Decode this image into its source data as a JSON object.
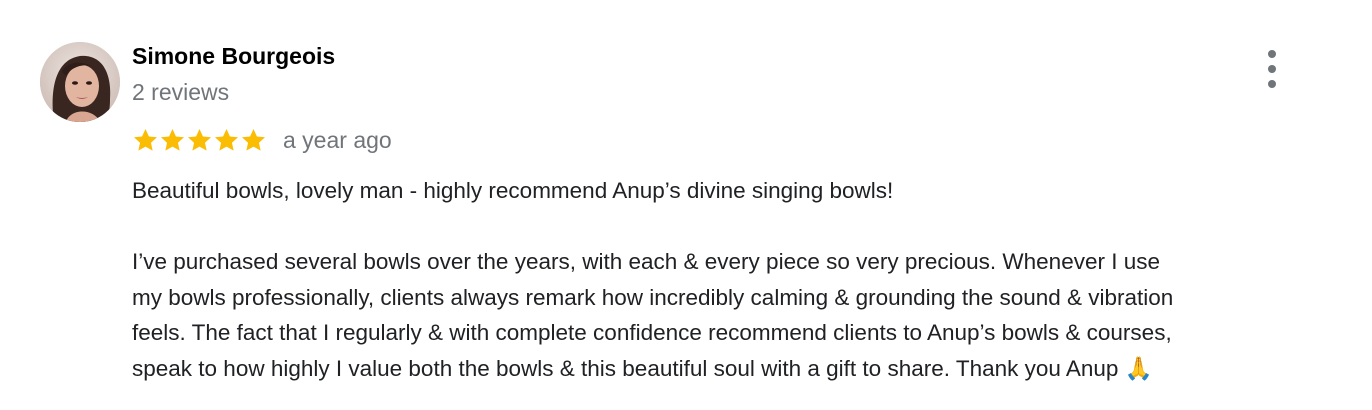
{
  "review": {
    "author_name": "Simone Bourgeois",
    "reviews_count": "2 reviews",
    "rating": 5,
    "rating_max": 5,
    "star_color": "#fbbc04",
    "time_ago": "a year ago",
    "more_icon": "more-vert-icon",
    "text": {
      "paragraph1": "Beautiful bowls, lovely man - highly recommend Anup’s divine singing bowls!",
      "paragraph2_lines": [
        "I’ve purchased several bowls over the years, with each & every piece so very precious. Whenever I use",
        "my bowls professionally, clients always remark how incredibly calming & grounding the sound & vibration",
        "feels. The fact that I regularly & with complete confidence recommend clients to Anup’s bowls & courses,",
        "speak to how highly I value both the bowls & this beautiful soul with a gift to share. Thank you Anup 🙏"
      ]
    }
  }
}
